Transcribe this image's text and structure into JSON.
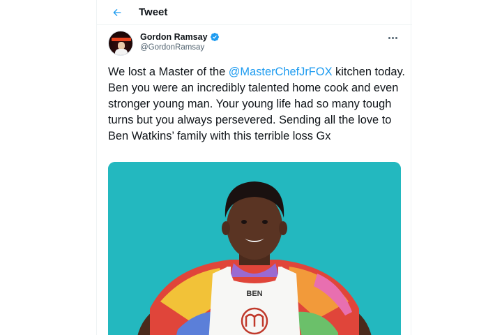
{
  "header": {
    "title": "Tweet"
  },
  "author": {
    "display_name": "Gordon Ramsay",
    "handle": "@GordonRamsay",
    "verified": true
  },
  "tweet": {
    "text_before": "We lost a Master of the ",
    "mention": "@MasterChefJrFOX",
    "text_after": " kitchen today. Ben you were an incredibly talented home cook and even stronger young man. Your young life had so many tough turns but you always persevered. Sending all the love to Ben Watkins’ family with this terrible loss Gx"
  },
  "media": {
    "apron_name": "BEN",
    "background_color": "#23b8bf"
  },
  "colors": {
    "accent": "#1d9bf0",
    "text": "#0f1419",
    "secondary_text": "#536471"
  },
  "icons": {
    "back": "arrow-left-icon",
    "verified": "verified-badge-icon",
    "more": "more-horizontal-icon"
  }
}
